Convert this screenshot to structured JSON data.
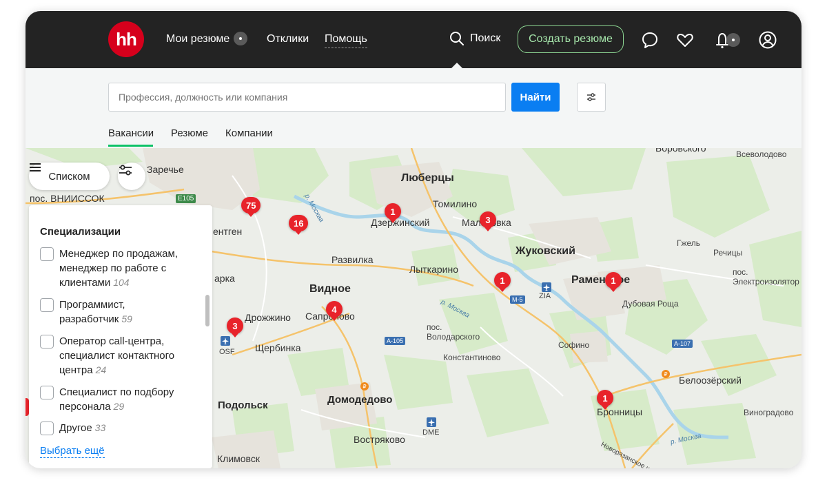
{
  "header": {
    "logo": "hh",
    "nav": {
      "resumes": "Мои резюме",
      "responses": "Отклики",
      "help": "Помощь"
    },
    "search_label": "Поиск",
    "create_resume": "Создать резюме"
  },
  "search": {
    "placeholder": "Профессия, должность или компания",
    "find_button": "Найти",
    "tabs": [
      "Вакансии",
      "Резюме",
      "Компании"
    ]
  },
  "map": {
    "list_button": "Списком",
    "labels": {
      "zarechye": "Заречье",
      "vniissok": "пос. ВНИИССОК",
      "e105": "E105",
      "lyubertsy": "Люберцы",
      "tomilino": "Томилино",
      "dzerzhinsky": "Дзержинский",
      "malakhovka": "Малаховка",
      "zhukovsky": "Жуковский",
      "ramenskoe": "Раменское",
      "gzhel": "Гжель",
      "rechitsy": "Речицы",
      "elektroizolyator": "пос.\nЭлектроизолятор",
      "dubovaya_roshcha": "Дубовая Роща",
      "vsevolodovo": "Всеволодово",
      "borovskoe": "Боровского",
      "rentgen": "ентген",
      "razvilka": "Развилка",
      "lytkarino": "Лыткарино",
      "vidnoe": "Видное",
      "park": "арка",
      "drozhzhino": "Дрожжино",
      "sapronovo": "Сапроново",
      "shcherbinka": "Щербинка",
      "volodarsky": "пос.\nВолодарского",
      "konstantinovo": "Константиново",
      "sofino": "Софино",
      "a105": "А-105",
      "a107": "А-107",
      "m5": "М-5",
      "zia": "ZIA",
      "osf": "OSF",
      "dme": "DME",
      "belozersky": "Белоозёрский",
      "podolsk": "Подольск",
      "domodedovo": "Домодедово",
      "bronnitsy": "Бронницы",
      "vinogradovo": "Виноградово",
      "vostryakovo": "Востряково",
      "klimovsk": "Климовск",
      "novoryazanskoe": "Новорязанское ш",
      "moskva_river_1": "р. Москва",
      "moskva_river_2": "р. Москва",
      "moskva_river_3": "р. Москва"
    },
    "markers": {
      "m75": "75",
      "m16": "16",
      "m1a": "1",
      "m3a": "3",
      "m1b": "1",
      "m1c": "1",
      "m4": "4",
      "m3b": "3",
      "m1d": "1"
    }
  },
  "panel": {
    "title": "Специализации",
    "items": [
      {
        "label": "Менеджер по продажам, менеджер по работе с клиентами",
        "count": "104"
      },
      {
        "label": "Программист, разработчик",
        "count": "59"
      },
      {
        "label": "Оператор call-центра, специалист контактного центра",
        "count": "24"
      },
      {
        "label": "Специалист по подбору персонала",
        "count": "29"
      },
      {
        "label": "Другое",
        "count": "33"
      }
    ],
    "more": "Выбрать ещё"
  }
}
